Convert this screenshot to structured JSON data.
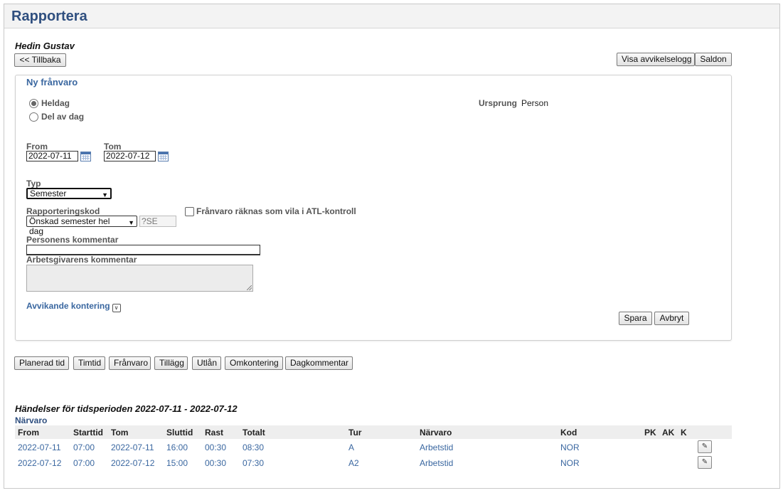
{
  "page": {
    "title": "Rapportera",
    "person_name": "Hedin Gustav",
    "back_button": "<< Tillbaka",
    "log_button": "Visa avvikelselogg",
    "balance_button": "Saldon"
  },
  "form": {
    "title": "Ny frånvaro",
    "radio_fullday": "Heldag",
    "radio_partday": "Del av dag",
    "origin_label": "Ursprung",
    "origin_value": "Person",
    "from_label": "From",
    "from_value": "2022-07-11",
    "to_label": "Tom",
    "to_value": "2022-07-12",
    "type_label": "Typ",
    "type_value": "Semester",
    "code_label": "Rapporteringskod",
    "code_value": "Önskad semester hel dag",
    "code_short": "?SE",
    "atl_label": "Frånvaro räknas som vila i ATL-kontroll",
    "person_comment_label": "Personens kommentar",
    "person_comment_value": "",
    "employer_comment_label": "Arbetsgivarens kommentar",
    "deviant_label": "Avvikande kontering",
    "save_button": "Spara",
    "cancel_button": "Avbryt"
  },
  "toolbar": {
    "buttons": [
      "Planerad tid",
      "Timtid",
      "Frånvaro",
      "Tillägg",
      "Utlån",
      "Omkontering",
      "Dagkommentar"
    ]
  },
  "events": {
    "heading": "Händelser för tidsperioden 2022-07-11 - 2022-07-12",
    "subsection": "Närvaro",
    "columns": [
      "From",
      "Starttid",
      "Tom",
      "Sluttid",
      "Rast",
      "Totalt",
      "Tur",
      "Närvaro",
      "Kod",
      "PK",
      "AK",
      "K"
    ],
    "rows": [
      {
        "from": "2022-07-11",
        "start": "07:00",
        "to": "2022-07-11",
        "end": "16:00",
        "break": "00:30",
        "total": "08:30",
        "tur": "A",
        "presence": "Arbetstid",
        "code": "NOR"
      },
      {
        "from": "2022-07-12",
        "start": "07:00",
        "to": "2022-07-12",
        "end": "15:00",
        "break": "00:30",
        "total": "07:30",
        "tur": "A2",
        "presence": "Arbetstid",
        "code": "NOR"
      }
    ]
  },
  "icons": {
    "calendar": "calendar-icon",
    "edit": "pencil-icon",
    "expand": "expand-down-icon"
  },
  "colors": {
    "title": "#2f4f7f",
    "link": "#3a67a0"
  }
}
